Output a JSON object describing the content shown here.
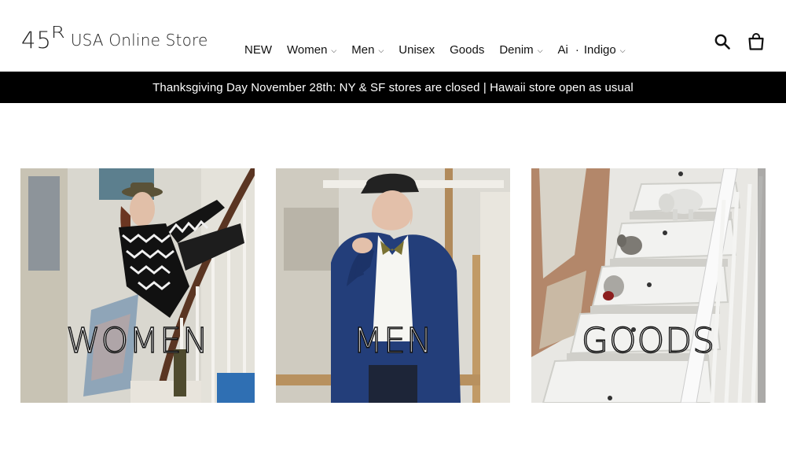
{
  "header": {
    "logo_mark": "45",
    "logo_r": "R",
    "logo_text": "USA Online Store"
  },
  "nav": {
    "items": [
      {
        "label": "NEW",
        "has_dropdown": false
      },
      {
        "label": "Women",
        "has_dropdown": true
      },
      {
        "label": "Men",
        "has_dropdown": true
      },
      {
        "label": "Unisex",
        "has_dropdown": false
      },
      {
        "label": "Goods",
        "has_dropdown": false
      },
      {
        "label": "Denim",
        "has_dropdown": true
      },
      {
        "label": "Ai",
        "has_dropdown": false
      },
      {
        "label": "Indigo",
        "has_dropdown": true
      }
    ],
    "separator": "·",
    "chevron": "⌄"
  },
  "icons": {
    "search": "search-icon",
    "cart": "cart-icon"
  },
  "announcement": {
    "text": "Thanksgiving Day November 28th: NY & SF stores are closed | Hawaii store open as usual",
    "background": "#000000",
    "color": "#ffffff"
  },
  "collections": [
    {
      "label": "WOMEN"
    },
    {
      "label": "MEN"
    },
    {
      "label": "GOODS"
    }
  ]
}
